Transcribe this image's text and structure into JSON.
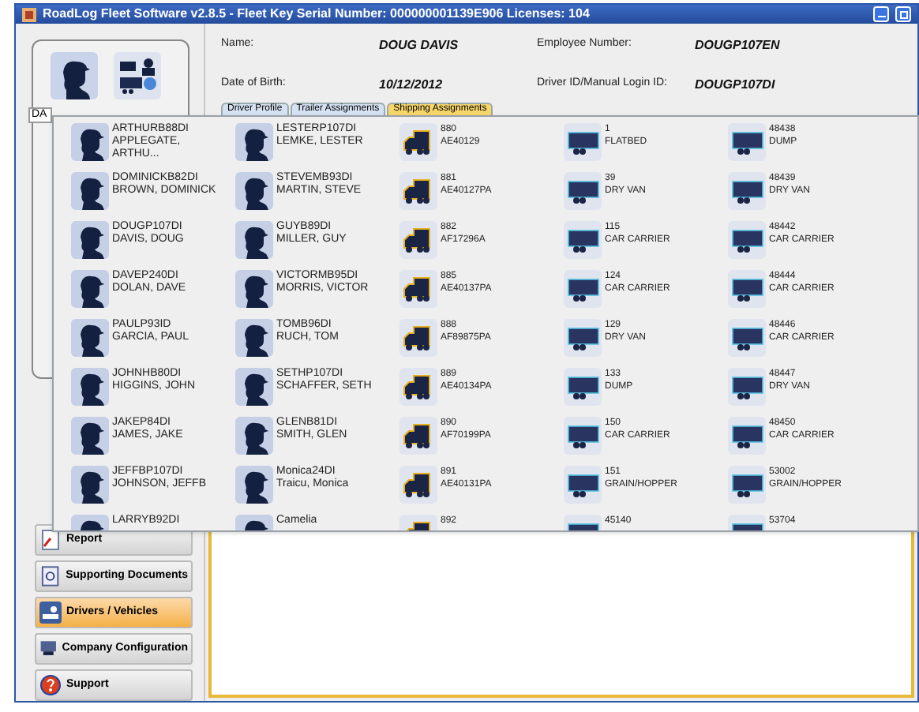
{
  "window": {
    "title": "RoadLog Fleet Software v2.8.5 - Fleet Key Serial Number: 000000001139E906 Licenses: 104"
  },
  "details": [
    {
      "label": "Name:",
      "value": "DOUG DAVIS"
    },
    {
      "label": "Employee Number:",
      "value": "DOUGP107EN"
    },
    {
      "label": "Date of Birth:",
      "value": "10/12/2012"
    },
    {
      "label": "Driver ID/Manual Login ID:",
      "value": "DOUGP107DI"
    }
  ],
  "search_field": {
    "value": "DA"
  },
  "tabs": [
    {
      "label": "Driver Profile",
      "selected": false
    },
    {
      "label": "Trailer Assignments",
      "selected": false
    },
    {
      "label": "Shipping Assignments",
      "selected": true
    }
  ],
  "assignment_grid": {
    "rows": [
      [
        {
          "kind": "driver",
          "lines": [
            "ARTHURB88DI",
            "APPLEGATE,",
            "ARTHU..."
          ]
        },
        {
          "kind": "driver",
          "lines": [
            "LESTERP107DI",
            "LEMKE, LESTER"
          ]
        },
        {
          "kind": "truck",
          "lines": [
            "880",
            "AE40129"
          ]
        },
        {
          "kind": "trailer",
          "lines": [
            "1",
            "FLATBED"
          ]
        },
        {
          "kind": "trailer",
          "lines": [
            "48438",
            "DUMP"
          ]
        }
      ],
      [
        {
          "kind": "driver",
          "lines": [
            "DOMINICKB82DI",
            "BROWN, DOMINICK"
          ]
        },
        {
          "kind": "driver",
          "lines": [
            "STEVEMB93DI",
            "MARTIN, STEVE"
          ]
        },
        {
          "kind": "truck",
          "lines": [
            "881",
            "AE40127PA"
          ]
        },
        {
          "kind": "trailer",
          "lines": [
            "39",
            "DRY VAN"
          ]
        },
        {
          "kind": "trailer",
          "lines": [
            "48439",
            "DRY VAN"
          ]
        }
      ],
      [
        {
          "kind": "driver",
          "lines": [
            "DOUGP107DI",
            "DAVIS, DOUG"
          ]
        },
        {
          "kind": "driver",
          "lines": [
            "GUYB89DI",
            "MILLER, GUY"
          ]
        },
        {
          "kind": "truck",
          "lines": [
            "882",
            "AF17296A"
          ]
        },
        {
          "kind": "trailer",
          "lines": [
            "115",
            "CAR CARRIER"
          ]
        },
        {
          "kind": "trailer",
          "lines": [
            "48442",
            "CAR CARRIER"
          ]
        }
      ],
      [
        {
          "kind": "driver",
          "lines": [
            "DAVEP240DI",
            "DOLAN, DAVE"
          ]
        },
        {
          "kind": "driver",
          "lines": [
            "VICTORMB95DI",
            "MORRIS, VICTOR"
          ]
        },
        {
          "kind": "truck",
          "lines": [
            "885",
            "AE40137PA"
          ]
        },
        {
          "kind": "trailer",
          "lines": [
            "124",
            "CAR CARRIER"
          ]
        },
        {
          "kind": "trailer",
          "lines": [
            "48444",
            "CAR CARRIER"
          ]
        }
      ],
      [
        {
          "kind": "driver",
          "lines": [
            "PAULP93ID",
            "GARCIA, PAUL"
          ]
        },
        {
          "kind": "driver",
          "lines": [
            "TOMB96DI",
            "RUCH, TOM"
          ]
        },
        {
          "kind": "truck",
          "lines": [
            "888",
            "AF89875PA"
          ]
        },
        {
          "kind": "trailer",
          "lines": [
            "129",
            "DRY VAN"
          ]
        },
        {
          "kind": "trailer",
          "lines": [
            "48446",
            "CAR CARRIER"
          ]
        }
      ],
      [
        {
          "kind": "driver",
          "lines": [
            "JOHNHB80DI",
            "HIGGINS, JOHN"
          ]
        },
        {
          "kind": "driver",
          "lines": [
            "SETHP107DI",
            "SCHAFFER, SETH"
          ]
        },
        {
          "kind": "truck",
          "lines": [
            "889",
            "AE40134PA"
          ]
        },
        {
          "kind": "trailer",
          "lines": [
            "133",
            "DUMP"
          ]
        },
        {
          "kind": "trailer",
          "lines": [
            "48447",
            "DRY VAN"
          ]
        }
      ],
      [
        {
          "kind": "driver",
          "lines": [
            "JAKEP84DI",
            "JAMES, JAKE"
          ]
        },
        {
          "kind": "driver",
          "lines": [
            "GLENB81DI",
            "SMITH, GLEN"
          ]
        },
        {
          "kind": "truck",
          "lines": [
            "890",
            "AF70199PA"
          ]
        },
        {
          "kind": "trailer",
          "lines": [
            "150",
            "CAR CARRIER"
          ]
        },
        {
          "kind": "trailer",
          "lines": [
            "48450",
            "CAR CARRIER"
          ]
        }
      ],
      [
        {
          "kind": "driver",
          "lines": [
            "JEFFBP107DI",
            "JOHNSON, JEFFB"
          ]
        },
        {
          "kind": "driver",
          "lines": [
            "Monica24DI",
            "Traicu, Monica"
          ]
        },
        {
          "kind": "truck",
          "lines": [
            "891",
            "AE40131PA"
          ]
        },
        {
          "kind": "trailer",
          "lines": [
            "151",
            "GRAIN/HOPPER"
          ]
        },
        {
          "kind": "trailer",
          "lines": [
            "53002",
            "GRAIN/HOPPER"
          ]
        }
      ],
      [
        {
          "kind": "driver",
          "lines": [
            "LARRYB92DI"
          ]
        },
        {
          "kind": "driver",
          "lines": [
            "Camelia"
          ]
        },
        {
          "kind": "truck",
          "lines": [
            "892"
          ]
        },
        {
          "kind": "trailer",
          "lines": [
            "45140"
          ]
        },
        {
          "kind": "trailer",
          "lines": [
            "53704"
          ]
        }
      ]
    ]
  },
  "nav": [
    {
      "kind": "report",
      "label": "Report",
      "selected": false
    },
    {
      "kind": "documents",
      "label": "Supporting Documents",
      "selected": false
    },
    {
      "kind": "drivers",
      "label": "Drivers / Vehicles",
      "selected": true
    },
    {
      "kind": "company",
      "label": "Company Configuration",
      "selected": false
    },
    {
      "kind": "support",
      "label": "Support",
      "selected": false
    }
  ]
}
